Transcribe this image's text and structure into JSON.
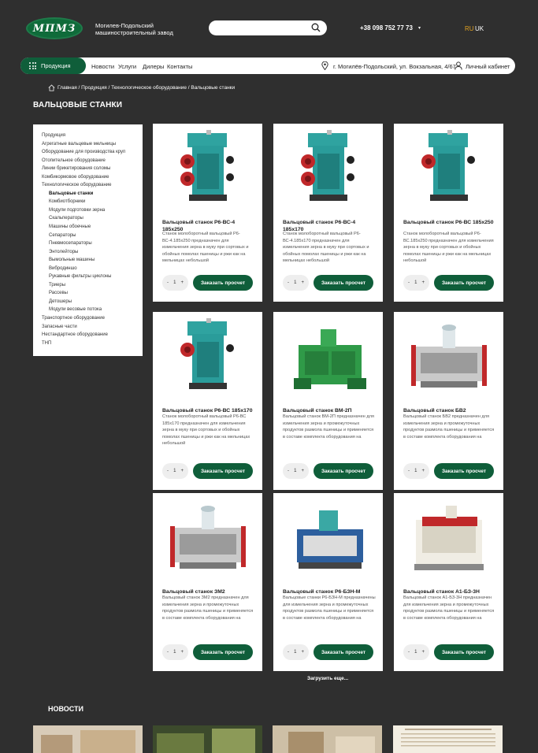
{
  "header": {
    "logo_text": "МПМЗ",
    "company_line1": "Могилев-Подольский",
    "company_line2": "машиностроительный завод",
    "search_placeholder": "",
    "phone": "+38 098 752 77 73",
    "phone_caret": "▾",
    "lang_ru": "RU",
    "lang_uk": "UK",
    "colors": {
      "brand": "#0f5e3a",
      "lang_active": "#e0a020",
      "background": "#2f2f2f"
    }
  },
  "nav": {
    "catalog": "Продукция",
    "links": [
      "Новости",
      "Услуги",
      "Дилеры",
      "Контакты"
    ],
    "address": "г. Могилёв-Подольский, ул. Вокзальная, 4/67",
    "cabinet": "Личный кабинет"
  },
  "breadcrumb": "Главная / Продукция / Технологическое оборудование / Вальцовые станки",
  "page_title": "ВАЛЬЦОВЫЕ СТАНКИ",
  "sidebar": {
    "items": [
      {
        "label": "Продукция",
        "sub": false,
        "active": false
      },
      {
        "label": "Агрегатные вальцевые мельницы",
        "sub": false,
        "active": false
      },
      {
        "label": "Оборудование для производства круп",
        "sub": false,
        "active": false
      },
      {
        "label": "Отопительное оборудование",
        "sub": false,
        "active": false
      },
      {
        "label": "Линии брикетирования соломы",
        "sub": false,
        "active": false
      },
      {
        "label": "Комбикормовое оборудование",
        "sub": false,
        "active": false
      },
      {
        "label": "Технологическое оборудование",
        "sub": false,
        "active": false
      },
      {
        "label": "Вальцовые станки",
        "sub": true,
        "active": true
      },
      {
        "label": "Комбиотборники",
        "sub": true,
        "active": false
      },
      {
        "label": "Модули подготовки зерна",
        "sub": true,
        "active": false
      },
      {
        "label": "Скальператоры",
        "sub": true,
        "active": false
      },
      {
        "label": "Машины обоечные",
        "sub": true,
        "active": false
      },
      {
        "label": "Сепараторы",
        "sub": true,
        "active": false
      },
      {
        "label": "Пневмосепараторы",
        "sub": true,
        "active": false
      },
      {
        "label": "Энтолейторы",
        "sub": true,
        "active": false
      },
      {
        "label": "Вымольные машины",
        "sub": true,
        "active": false
      },
      {
        "label": "Вибродиншо",
        "sub": true,
        "active": false
      },
      {
        "label": "Рукавные фильтры циклоны",
        "sub": true,
        "active": false
      },
      {
        "label": "Триеры",
        "sub": true,
        "active": false
      },
      {
        "label": "Рассевы",
        "sub": true,
        "active": false
      },
      {
        "label": "Детошеры",
        "sub": true,
        "active": false
      },
      {
        "label": "Модули весовые потока",
        "sub": true,
        "active": false
      },
      {
        "label": "Транспортное оборудование",
        "sub": false,
        "active": false
      },
      {
        "label": "Запасные части",
        "sub": false,
        "active": false
      },
      {
        "label": "Нестандартное оборудование",
        "sub": false,
        "active": false
      },
      {
        "label": "ТНП",
        "sub": false,
        "active": false
      }
    ]
  },
  "products": [
    {
      "name": "Вальцовый станок Р6-ВС-4 185х250",
      "desc": "Станок молоборотный вальцовый Р6-ВС-4.185х250 предназначен для измельчения зерна в муку при сортовых и обойных помолах пшеницы и ржи как на мельницах небольшой",
      "machine": "teal-double"
    },
    {
      "name": "Вальцовый станок Р6-ВС-4 185х170",
      "desc": "Станок молоборотный вальцовый Р6-ВС-4.185х170 предназначен для измельчения зерна в муку при сортовых и обойных помолах пшеницы и ржи как на мельницах небольшой",
      "machine": "teal-double"
    },
    {
      "name": "Вальцовый станок Р6-ВС 185х250",
      "desc": "Станок молоборотный вальцовый Р6-ВС.185х250 предназначен для измельчения зерна в муку при сортовых и обойных помолах пшеницы и ржи как на мельницах небольшой",
      "machine": "teal-single"
    },
    {
      "name": "Вальцовый станок Р6-ВС 185х170",
      "desc": "Станок молоборотный вальцовый Р6-ВС 185х170 предназначен для измельчения зерна в муку при сортовых и обойных помолах пшеницы и ржи как на мельницах небольшой",
      "machine": "teal-single"
    },
    {
      "name": "Вальцовый станок ВМ-2П",
      "desc": "Вальцовый станок ВМ-2П предназначен для измельчения зерна и промежуточных продуктов размола пшеницы и применяется в составе комплекта оборудования на",
      "machine": "green"
    },
    {
      "name": "Вальцовый станок БВ2",
      "desc": "Вальцовый станок БВ2 предназначен для измельчения зерна и промежуточных продуктов размола пшеницы и применяется в составе комплекта оборудования на",
      "machine": "grey"
    },
    {
      "name": "Вальцовый станок ЗМ2",
      "desc": "Вальцовый станок ЗМ2 предназначен для измельчения зерна и промежуточных продуктов размола пшеницы и применяется в составе комплекта оборудования на",
      "machine": "grey"
    },
    {
      "name": "Вальцовый станок Р6-БЗН-М",
      "desc": "Вальцовые станки Р6-БЗН-М предназначены для измельчения зерна и промежуточных продуктов размола пшеницы и применяется в составе комплекта оборудования на",
      "machine": "blue"
    },
    {
      "name": "Вальцовый станок А1-БЗ-3Н",
      "desc": "Вальцовый станок А1-БЗ-3Н предназначен для измельчения зерна и промежуточных продуктов размола пшеницы и применяется в составе комплекта оборудования на",
      "machine": "red"
    }
  ],
  "card_labels": {
    "minus": "-",
    "qty": "1",
    "plus": "+",
    "order": "Заказать просчет"
  },
  "load_more": "Загрузить еще...",
  "news_title": "НОВОСТИ"
}
